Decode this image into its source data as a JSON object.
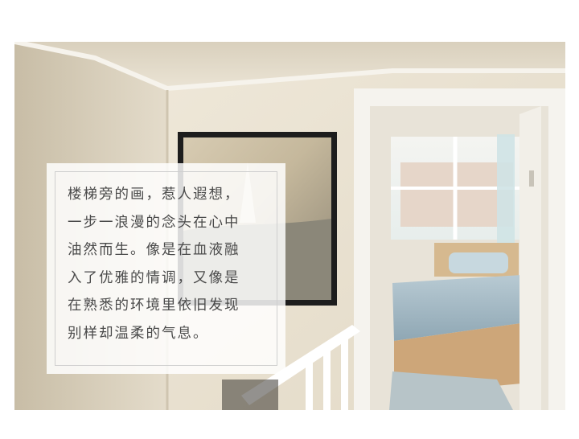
{
  "photo": {
    "subject": "staircase landing with framed painting and doorway to bedroom"
  },
  "caption": {
    "lines": [
      "楼梯旁的画，惹人遐想，",
      "一步一浪漫的念头在心中",
      "油然而生。像是在血液融",
      "入了优雅的情调，又像是",
      "在熟悉的环境里依旧发现",
      "别样却温柔的气息。"
    ]
  },
  "colors": {
    "wall": "#e9e2d3",
    "trim": "#f7f5f0",
    "bedding": "#9fb6c2",
    "caption_text": "#4a4a4a"
  }
}
